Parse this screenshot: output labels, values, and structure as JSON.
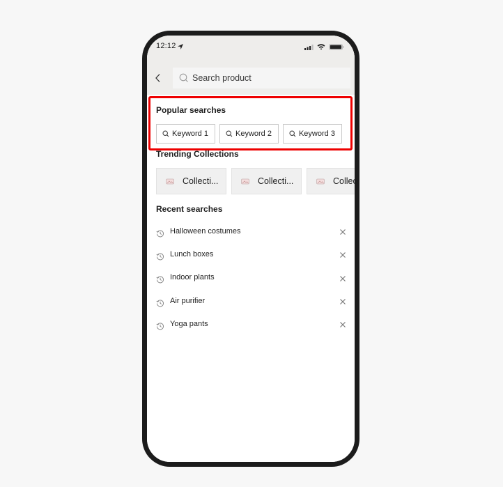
{
  "status_bar": {
    "time": "12:12",
    "icons": [
      "location-arrow-icon",
      "signal-icon",
      "wifi-icon",
      "battery-icon"
    ]
  },
  "header": {
    "back_icon": "chevron-left-icon",
    "search": {
      "placeholder": "Search product",
      "value": "",
      "icon": "search-icon"
    }
  },
  "popular": {
    "title": "Popular searches",
    "keywords": [
      {
        "label": "Keyword 1",
        "icon": "search-icon"
      },
      {
        "label": "Keyword 2",
        "icon": "search-icon"
      },
      {
        "label": "Keyword 3",
        "icon": "search-icon"
      }
    ]
  },
  "trending": {
    "title": "Trending Collections",
    "collections": [
      {
        "label": "Collecti...",
        "icon": "image-placeholder-icon"
      },
      {
        "label": "Collecti...",
        "icon": "image-placeholder-icon"
      },
      {
        "label": "Collecti...",
        "icon": "image-placeholder-icon"
      }
    ]
  },
  "recent": {
    "title": "Recent searches",
    "items": [
      {
        "label": "Halloween costumes"
      },
      {
        "label": "Lunch boxes"
      },
      {
        "label": "Indoor plants"
      },
      {
        "label": "Air purifier"
      },
      {
        "label": "Yoga pants"
      }
    ],
    "item_icon": "history-icon",
    "remove_icon": "close-icon"
  },
  "annotation": {
    "highlight_color": "#ee0000",
    "highlighted_section": "Popular searches"
  },
  "colors": {
    "header_bg": "#eeedeb",
    "search_bg": "#f5f5f5",
    "phone_frame": "#1c1c1c",
    "page_bg": "#f7f7f7"
  }
}
